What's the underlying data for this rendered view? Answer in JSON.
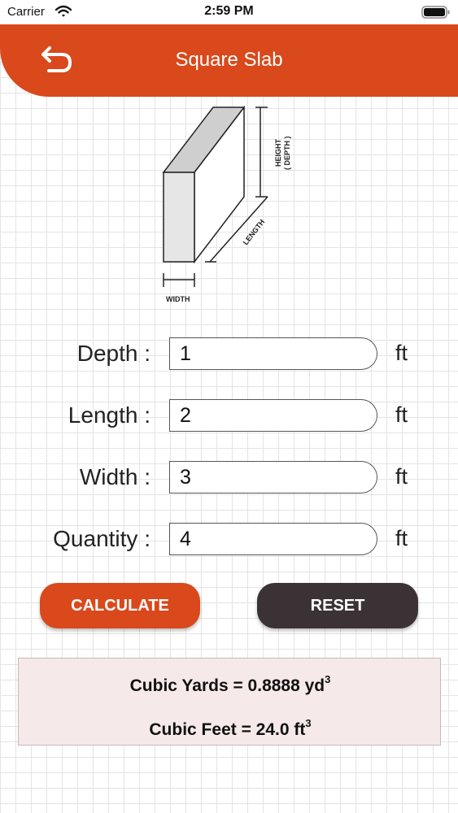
{
  "status_bar": {
    "carrier": "Carrier",
    "time": "2:59 PM"
  },
  "header": {
    "title": "Square Slab",
    "back_icon": "undo-arrow-icon"
  },
  "diagram": {
    "height_label": "HEIGHT",
    "depth_label": "( DEPTH )",
    "length_label": "LENGTH",
    "width_label": "WIDTH"
  },
  "form": {
    "fields": [
      {
        "label": "Depth :",
        "value": "1",
        "unit": "ft"
      },
      {
        "label": "Length :",
        "value": "2",
        "unit": "ft"
      },
      {
        "label": "Width :",
        "value": "3",
        "unit": "ft"
      },
      {
        "label": "Quantity :",
        "value": "4",
        "unit": "ft"
      }
    ]
  },
  "buttons": {
    "calculate": "CALCULATE",
    "reset": "RESET"
  },
  "results": {
    "cubic_yards_text": "Cubic Yards = 0.8888 yd",
    "cubic_yards_exp": "3",
    "cubic_feet_text": "Cubic Feet = 24.0 ft",
    "cubic_feet_exp": "3"
  },
  "colors": {
    "accent": "#d9491c",
    "dark_button": "#3a3234",
    "result_bg": "#f6e9e9"
  }
}
